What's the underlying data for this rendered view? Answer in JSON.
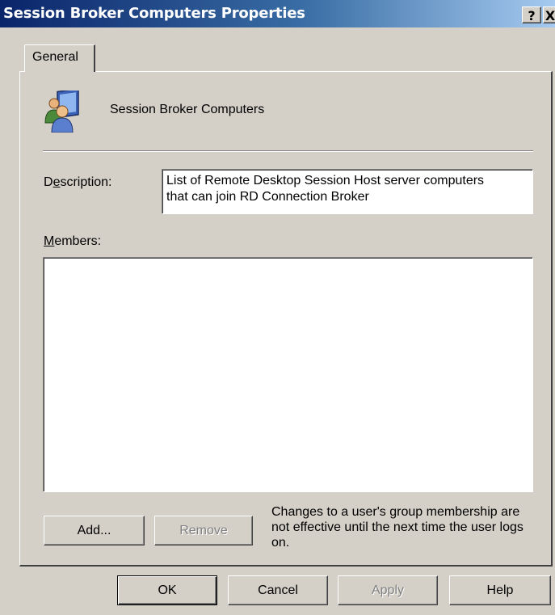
{
  "window": {
    "title": "Session Broker Computers Properties",
    "help_glyph": "?",
    "close_glyph": "X"
  },
  "tabs": [
    {
      "label": "General",
      "selected": true
    }
  ],
  "general": {
    "group_icon": "users-group-icon",
    "group_name": "Session Broker Computers",
    "description_label": "Description:",
    "description_value": "List of Remote Desktop Session Host server computers\nthat can join RD Connection Broker",
    "members_label": "Members:",
    "members": [],
    "add_label": "Add...",
    "remove_label": "Remove",
    "note": "Changes to a user's group membership are not effective until the next time the user logs on."
  },
  "footer": {
    "ok": "OK",
    "cancel": "Cancel",
    "apply": "Apply",
    "help": "Help"
  },
  "colors": {
    "face": "#d4d0c8",
    "title_start": "#0a246a",
    "title_end": "#a6caf0",
    "disabled_text": "#808080"
  }
}
